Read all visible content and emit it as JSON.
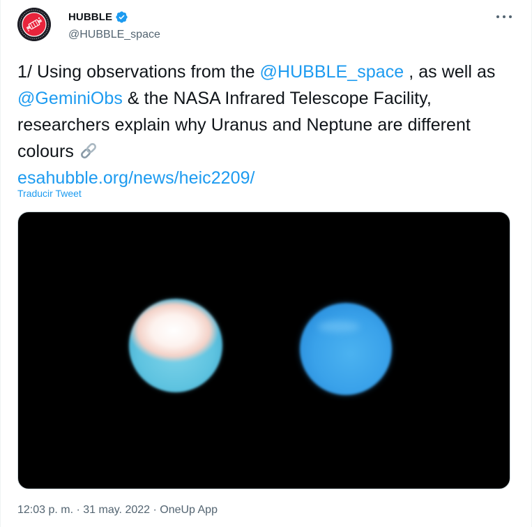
{
  "author": {
    "display_name": "HUBBLE",
    "handle": "@HUBBLE_space",
    "verified": true
  },
  "tweet": {
    "text_1": "1/ Using observations from the ",
    "mention_1": "@HUBBLE_space",
    "text_2": " , as well as ",
    "mention_2": "@GeminiObs",
    "text_3": " & the NASA Infrared Telescope Facility, researchers explain why Uranus and Neptune are different colours ",
    "link": "esahubble.org/news/heic2209/",
    "translate_label": "Traducir Tweet"
  },
  "media": {
    "icon": "image-uranus-neptune",
    "background": "#000000"
  },
  "meta": {
    "time": "12:03 p. m.",
    "separator": " · ",
    "date": "31 may. 2022",
    "source": "OneUp App"
  },
  "colors": {
    "link": "#1d9bf0",
    "verified": "#1d9bf0",
    "text": "#0f1419",
    "secondary": "#536471"
  },
  "icons": {
    "verified": "verified-badge-icon",
    "more": "more-options-icon",
    "chain": "link-emoji-icon"
  }
}
